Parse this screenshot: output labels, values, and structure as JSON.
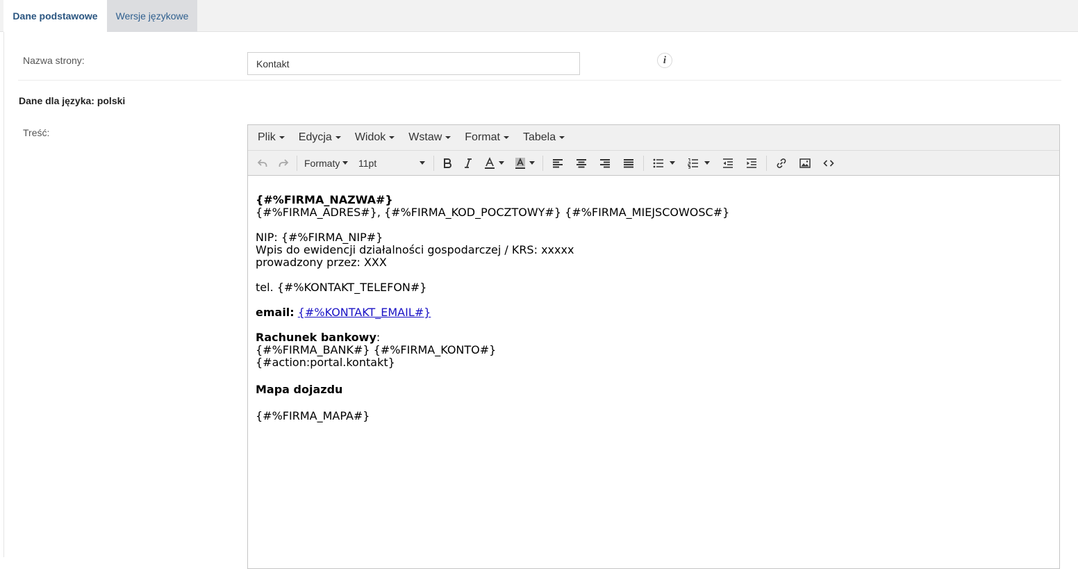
{
  "tabs": [
    {
      "label": "Dane podstawowe",
      "active": true
    },
    {
      "label": "Wersje językowe",
      "active": false
    }
  ],
  "form": {
    "page_name_label": "Nazwa strony:",
    "page_name_value": "Kontakt",
    "info_glyph": "i",
    "language_heading": "Dane dla języka: polski",
    "content_label": "Treść:"
  },
  "editor": {
    "menu": [
      "Plik",
      "Edycja",
      "Widok",
      "Wstaw",
      "Format",
      "Tabela"
    ],
    "toolbar": {
      "formats_label": "Formaty",
      "font_size": "11pt",
      "icons": [
        "undo-icon",
        "redo-icon",
        "bold-icon",
        "italic-icon",
        "text-color-icon",
        "background-color-icon",
        "align-left-icon",
        "align-center-icon",
        "align-right-icon",
        "align-justify-icon",
        "bullet-list-icon",
        "numbered-list-icon",
        "outdent-icon",
        "indent-icon",
        "link-icon",
        "image-icon",
        "source-code-icon"
      ]
    },
    "content": {
      "company_name": "{#%FIRMA_NAZWA#}",
      "address_line": "{#%FIRMA_ADRES#}, {#%FIRMA_KOD_POCZTOWY#} {#%FIRMA_MIEJSCOWOSC#}",
      "nip_line": "NIP: {#%FIRMA_NIP#}",
      "registry_line": "Wpis do ewidencji działalności gospodarczej / KRS: xxxxx",
      "kept_by_line": "prowadzony przez: XXX",
      "phone_line": "tel. {#%KONTAKT_TELEFON#}",
      "email_label": "email:",
      "email_value": "{#%KONTAKT_EMAIL#}",
      "bank_label": "Rachunek bankowy",
      "bank_colon": ":",
      "bank_line": "{#%FIRMA_BANK#} {#%FIRMA_KONTO#}",
      "action_line": "{#action:portal.kontakt}",
      "map_heading": "Mapa dojazdu",
      "map_line": "{#%FIRMA_MAPA#}"
    }
  }
}
